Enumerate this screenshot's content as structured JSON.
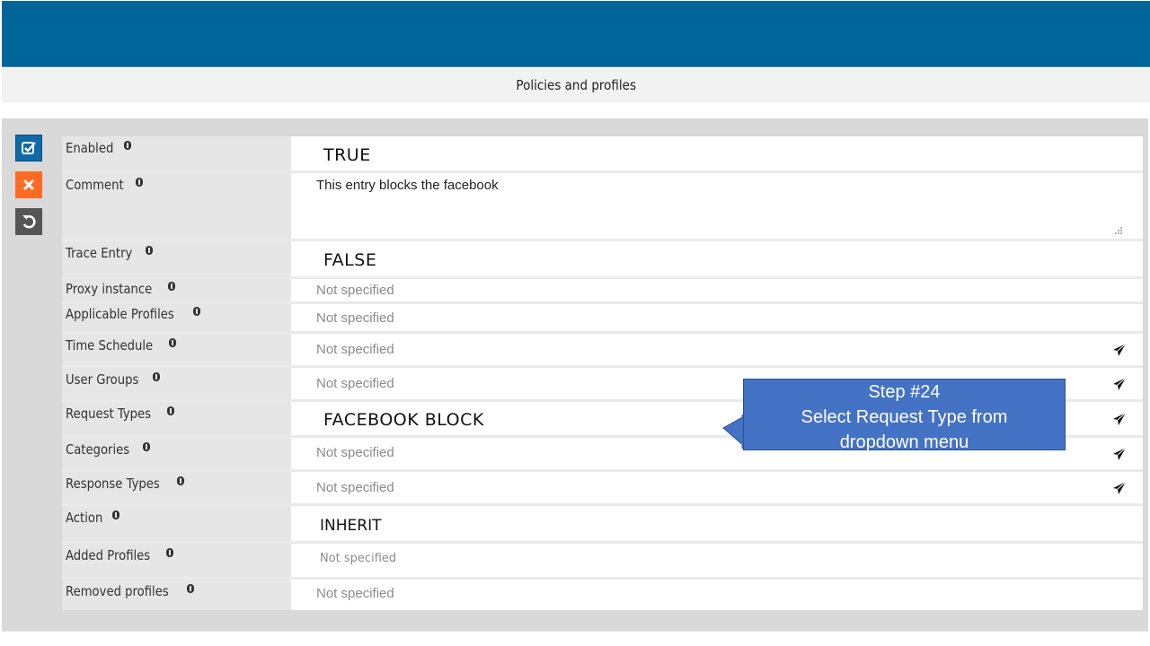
{
  "header": {
    "title": "Policies and profiles"
  },
  "side_actions": {
    "save_icon": "checkbox-icon",
    "cancel_icon": "close-icon",
    "reset_icon": "undo-icon",
    "colors": {
      "save": "#0e6aa6",
      "cancel": "#ff6b22",
      "reset": "#555555"
    }
  },
  "fields": [
    {
      "label": "Enabled",
      "value": "TRUE",
      "style": "big"
    },
    {
      "label": "Comment",
      "value": "This entry blocks the facebook",
      "style": "normal"
    },
    {
      "label": "Trace Entry",
      "value": "FALSE",
      "style": "big"
    },
    {
      "label": "Proxy instance",
      "value": "Not specified",
      "style": "muted"
    },
    {
      "label": "Applicable Profiles",
      "value": "Not specified",
      "style": "muted"
    },
    {
      "label": "Time Schedule",
      "value": "Not specified",
      "style": "muted",
      "has_picker": true
    },
    {
      "label": "User Groups",
      "value": "Not specified",
      "style": "muted",
      "has_picker": true
    },
    {
      "label": "Request Types",
      "value": "FACEBOOK BLOCK",
      "style": "big",
      "has_picker": true
    },
    {
      "label": "Categories",
      "value": "Not specified",
      "style": "muted",
      "has_picker": true
    },
    {
      "label": "Response Types",
      "value": "Not specified",
      "style": "muted",
      "has_picker": true
    },
    {
      "label": "Action",
      "value": "INHERIT",
      "style": "big"
    },
    {
      "label": "Added Profiles",
      "value": "Not specified",
      "style": "muted"
    },
    {
      "label": "Removed profiles",
      "value": "Not specified",
      "style": "muted"
    }
  ],
  "callout": {
    "line1": "Step #24",
    "line2": "Select Request Type from",
    "line3": "dropdown menu",
    "color": "#4472c4"
  },
  "brand_color": "#006699"
}
